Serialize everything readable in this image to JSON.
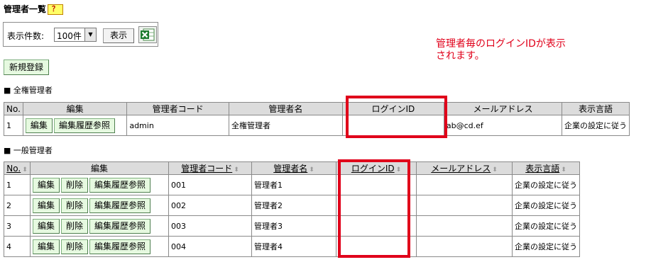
{
  "header": {
    "title": "管理者一覧",
    "help_label": "？"
  },
  "filter": {
    "label": "表示件数:",
    "selected": "100件",
    "show_button": "表示"
  },
  "new_button": "新規登録",
  "section_full": "■ 全権管理者",
  "section_general": "■ 一般管理者",
  "columns": {
    "no": "No.",
    "edit": "編集",
    "code": "管理者コード",
    "name": "管理者名",
    "login_id": "ログインID",
    "email": "メールアドレス",
    "language": "表示言語"
  },
  "buttons": {
    "edit": "編集",
    "delete": "削除",
    "history": "編集履歴参照"
  },
  "full_admin": {
    "no": "1",
    "code": "admin",
    "name": "全権管理者",
    "login_id": "",
    "email": "ab@cd.ef",
    "language": "企業の設定に従う"
  },
  "general_admins": [
    {
      "no": "1",
      "code": "001",
      "name": "管理者1",
      "login_id": "",
      "email": "",
      "language": "企業の設定に従う"
    },
    {
      "no": "2",
      "code": "002",
      "name": "管理者2",
      "login_id": "",
      "email": "",
      "language": "企業の設定に従う"
    },
    {
      "no": "3",
      "code": "003",
      "name": "管理者3",
      "login_id": "",
      "email": "",
      "language": "企業の設定に従う"
    },
    {
      "no": "4",
      "code": "004",
      "name": "管理者4",
      "login_id": "",
      "email": "",
      "language": "企業の設定に従う"
    }
  ],
  "annotation": {
    "line1": "管理者毎のログインIDが表示",
    "line2": "されます。"
  },
  "colors": {
    "annotation": "#e0001a",
    "green_button": "#e6f9e0",
    "header_bg": "#dcdcdc"
  }
}
